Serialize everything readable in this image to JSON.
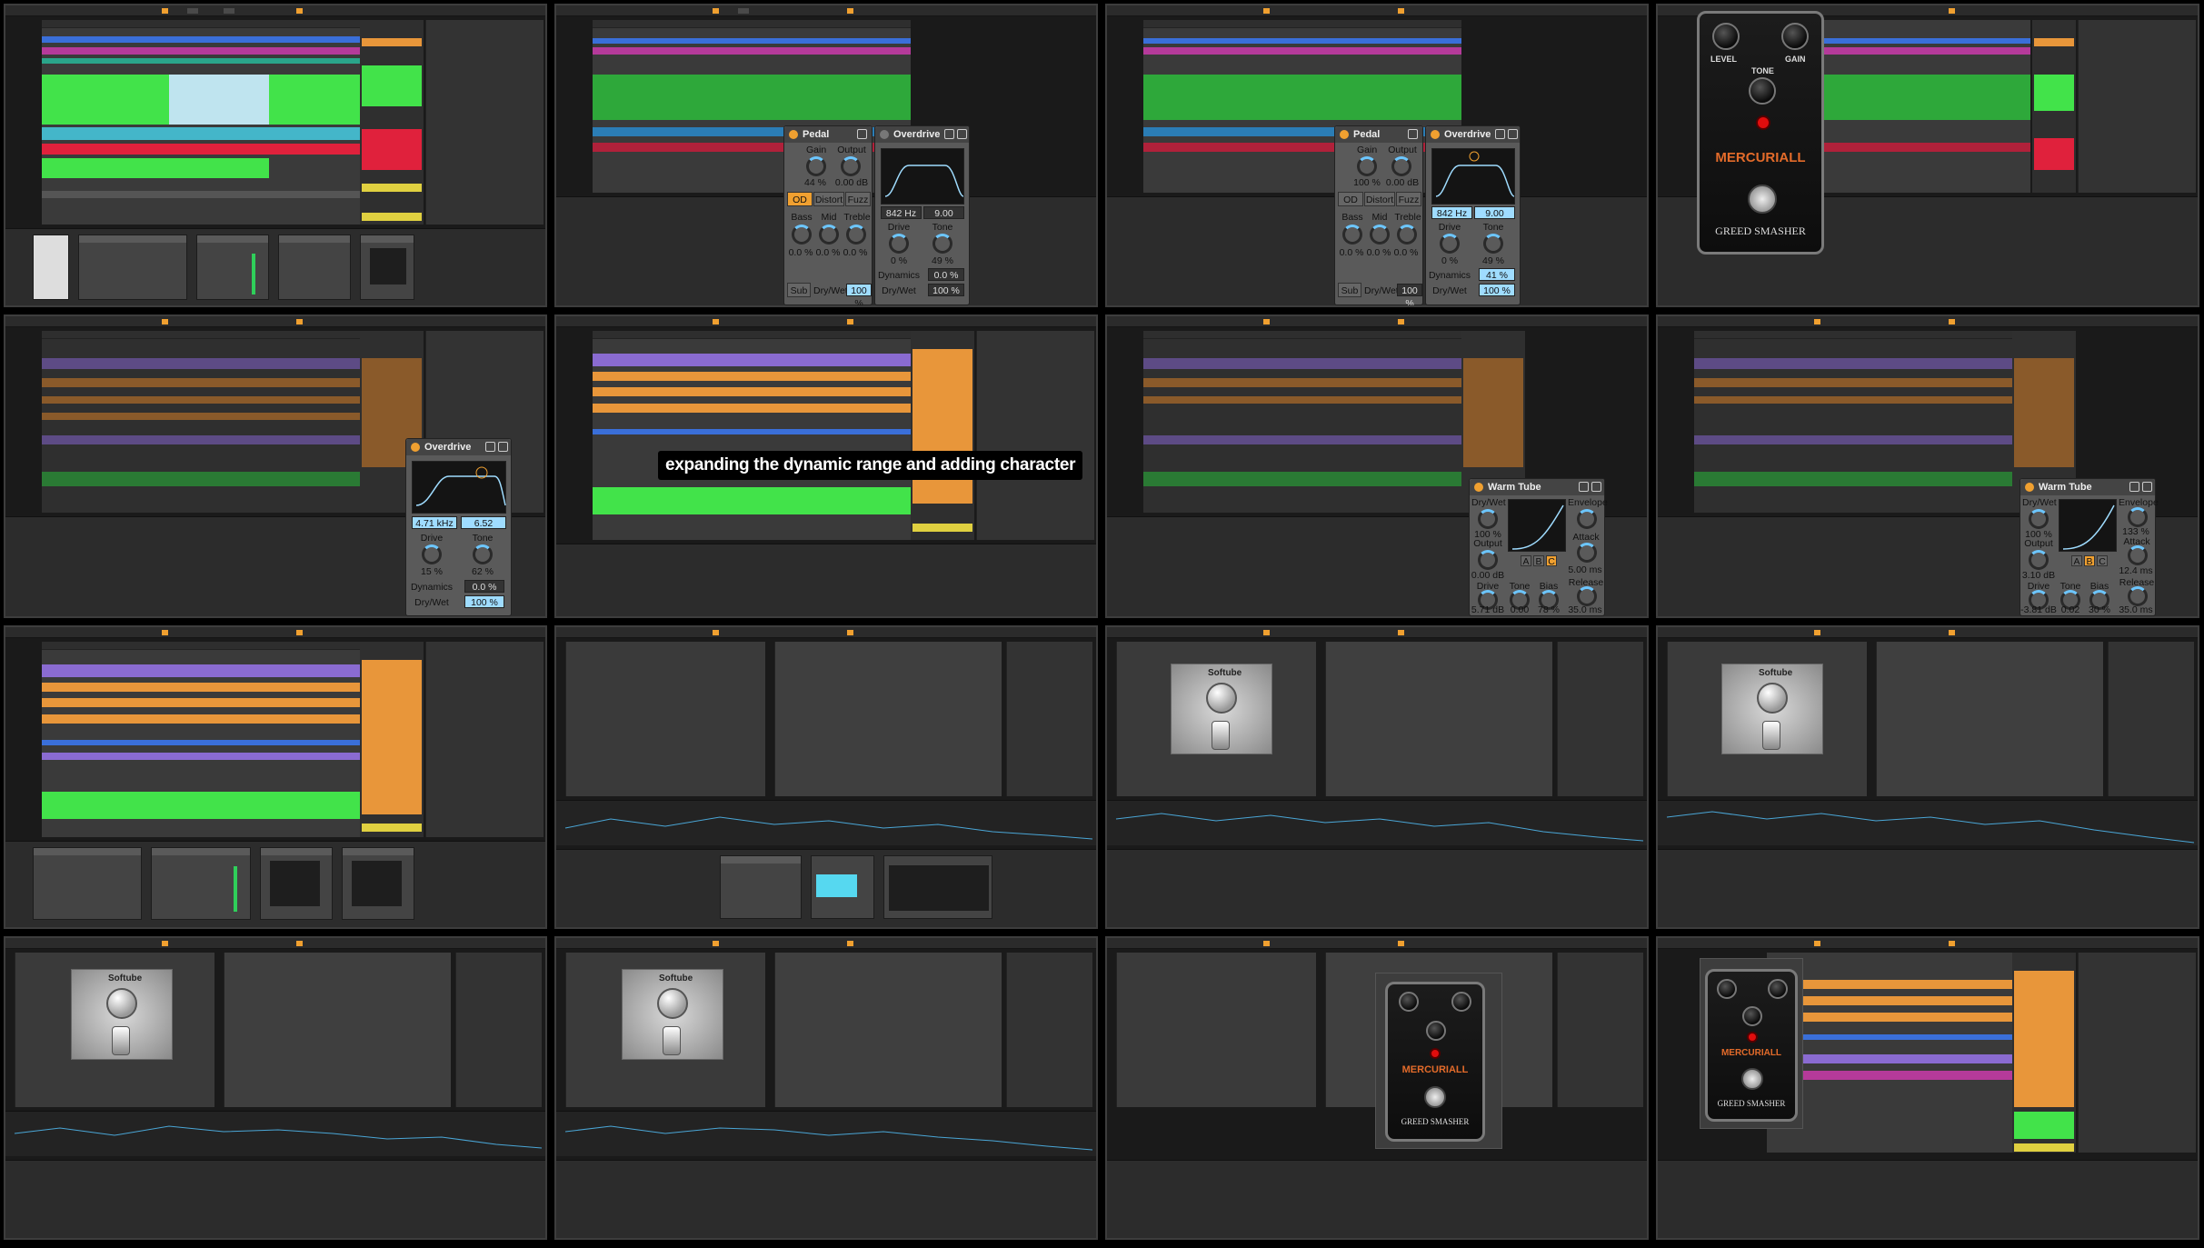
{
  "colors": {
    "green": "#42e34a",
    "orange": "#e8963a",
    "purple": "#8a6bd1",
    "magenta": "#b53a9a",
    "red": "#e0213c",
    "blue": "#3a6fd9",
    "teal": "#2aa58a",
    "accent": "#f0a030",
    "knob_indicator": "#6cc6ff"
  },
  "caption": {
    "text": "expanding the dynamic range and adding character"
  },
  "pedal_plugin_a": {
    "title": "Pedal",
    "gain_label": "Gain",
    "gain_value": "44 %",
    "output_label": "Output",
    "output_value": "0.00 dB",
    "modes": [
      "OD",
      "Distort",
      "Fuzz"
    ],
    "active_mode": "OD",
    "bass_label": "Bass",
    "bass_value": "0.0 %",
    "mid_label": "Mid",
    "mid_value": "0.0 %",
    "treble_label": "Treble",
    "treble_value": "0.0 %",
    "sub_label": "Sub",
    "drywet_label": "Dry/Wet",
    "drywet_value": "100 %"
  },
  "overdrive_a": {
    "title": "Overdrive",
    "freq": "842 Hz",
    "q": "9.00",
    "drive_label": "Drive",
    "drive_value": "0 %",
    "tone_label": "Tone",
    "tone_value": "49 %",
    "dynamics_label": "Dynamics",
    "dynamics_value": "0.0 %",
    "drywet_label": "Dry/Wet",
    "drywet_value": "100 %"
  },
  "pedal_plugin_b": {
    "title": "Pedal",
    "gain_label": "Gain",
    "gain_value": "100 %",
    "output_label": "Output",
    "output_value": "0.00 dB",
    "modes": [
      "OD",
      "Distort",
      "Fuzz"
    ],
    "bass_label": "Bass",
    "bass_value": "0.0 %",
    "mid_label": "Mid",
    "mid_value": "0.0 %",
    "treble_label": "Treble",
    "treble_value": "0.0 %",
    "sub_label": "Sub",
    "drywet_label": "Dry/Wet",
    "drywet_value": "100 %"
  },
  "overdrive_b": {
    "title": "Overdrive",
    "freq": "842 Hz",
    "q": "9.00",
    "drive_label": "Drive",
    "drive_value": "0 %",
    "tone_label": "Tone",
    "tone_value": "49 %",
    "dynamics_label": "Dynamics",
    "dynamics_value": "41 %",
    "drywet_label": "Dry/Wet",
    "drywet_value": "100 %"
  },
  "overdrive_c": {
    "title": "Overdrive",
    "freq": "4.71 kHz",
    "q": "6.52",
    "drive_label": "Drive",
    "drive_value": "15 %",
    "tone_label": "Tone",
    "tone_value": "62 %",
    "dynamics_label": "Dynamics",
    "dynamics_value": "0.0 %",
    "drywet_label": "Dry/Wet",
    "drywet_value": "100 %"
  },
  "warm_tube_a": {
    "title": "Warm Tube",
    "drywet_label": "Dry/Wet",
    "drywet_value": "100 %",
    "output_label": "Output",
    "output_value": "0.00 dB",
    "envelope_label": "Envelope",
    "attack_label": "Attack",
    "attack_value": "5.00 ms",
    "release_label": "Release",
    "release_value": "35.0 ms",
    "abc": [
      "A",
      "B",
      "C"
    ],
    "drive_label": "Drive",
    "drive_value": "5.71 dB",
    "tone_label": "Tone",
    "tone_value": "0.00",
    "bias_label": "Bias",
    "bias_value": "78 %"
  },
  "warm_tube_b": {
    "title": "Warm Tube",
    "drywet_label": "Dry/Wet",
    "drywet_value": "100 %",
    "output_label": "Output",
    "output_value": "3.10 dB",
    "envelope_label": "Envelope",
    "envelope_value": "133 %",
    "attack_label": "Attack",
    "attack_value": "12.4 ms",
    "release_label": "Release",
    "release_value": "35.0 ms",
    "abc": [
      "A",
      "B",
      "C"
    ],
    "drive_label": "Drive",
    "drive_value": "-3.81 dB",
    "tone_label": "Tone",
    "tone_value": "0.02",
    "bias_label": "Bias",
    "bias_value": "30 %"
  },
  "pedal_large": {
    "level_label": "LEVEL",
    "tone_label": "TONE",
    "gain_label": "GAIN",
    "brand": "MERCURIALL",
    "model": "GREED SMASHER"
  },
  "softube": {
    "brand": "Softube"
  }
}
